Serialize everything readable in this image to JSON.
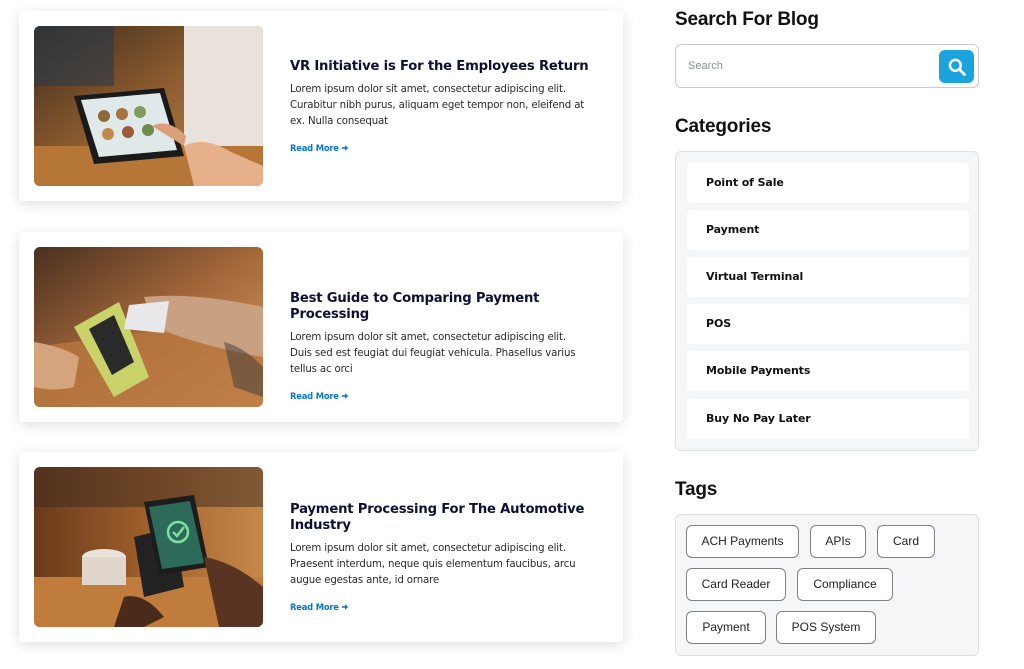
{
  "posts": [
    {
      "title": "VR Initiative is For the Employees Return",
      "excerpt": "Lorem ipsum dolor sit amet, consectetur adipiscing elit. Curabitur nibh purus, aliquam eget tempor non, eleifend at ex. Nulla consequat",
      "read_more": "Read More",
      "image": "tablet-ordering-photo"
    },
    {
      "title": "Best Guide to Comparing Payment Processing",
      "excerpt": "Lorem ipsum dolor sit amet, consectetur adipiscing elit. Duis sed est feugiat dui feugiat vehicula. Phasellus varius tellus ac orci",
      "read_more": "Read More",
      "image": "card-terminal-photo"
    },
    {
      "title": "Payment Processing For The Automotive Industry",
      "excerpt": "Lorem ipsum dolor sit amet, consectetur adipiscing elit. Praesent interdum, neque quis elementum faucibus, arcu augue egestas ante, id ornare",
      "read_more": "Read More",
      "image": "phone-payment-photo"
    }
  ],
  "sidebar": {
    "search_heading": "Search For Blog",
    "search_placeholder": "Search",
    "search_icon": "search-icon",
    "categories_heading": "Categories",
    "categories": [
      "Point of Sale",
      "Payment",
      "Virtual Terminal",
      "POS",
      "Mobile Payments",
      "Buy No Pay Later"
    ],
    "tags_heading": "Tags",
    "tags": [
      "ACH Payments",
      "APIs",
      "Card",
      "Card Reader",
      "Compliance",
      "Payment",
      "POS System"
    ]
  },
  "colors": {
    "accent": "#1aa3dd",
    "link": "#0a74c9",
    "title": "#0d1035",
    "panel_bg": "#f5f6f8"
  }
}
